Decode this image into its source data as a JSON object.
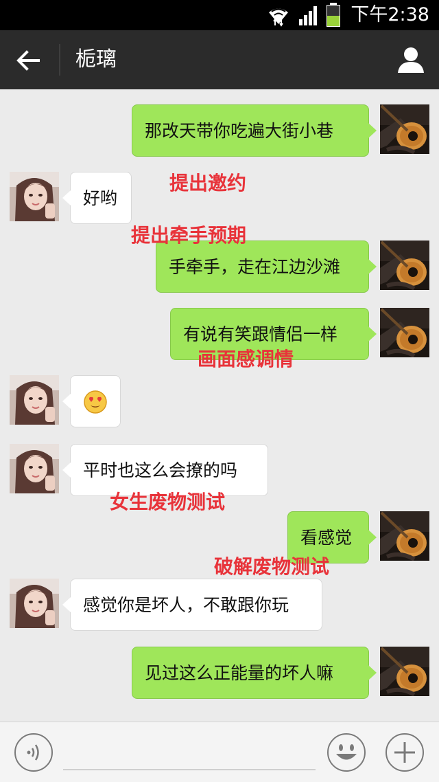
{
  "status_bar": {
    "time": "下午2:38"
  },
  "header": {
    "back_icon": "arrow-left-icon",
    "title": "栀璃",
    "profile_icon": "person-icon"
  },
  "messages": [
    {
      "side": "out",
      "text": "那改天带你吃遍大街小巷"
    },
    {
      "side": "in",
      "text": "好哟"
    },
    {
      "side": "out",
      "text": "手牵手，走在江边沙滩"
    },
    {
      "side": "out",
      "text": "有说有笑跟情侣一样"
    },
    {
      "side": "in",
      "text": "",
      "emoji": "heart-eyes-emoji"
    },
    {
      "side": "in",
      "text": "平时也这么会撩的吗"
    },
    {
      "side": "out",
      "text": "看感觉"
    },
    {
      "side": "in",
      "text": "感觉你是坏人，不敢跟你玩"
    },
    {
      "side": "out",
      "text": "见过这么正能量的坏人嘛"
    }
  ],
  "annotations": [
    "提出邀约",
    "提出牵手预期",
    "画面感调情",
    "女生废物测试",
    "破解废物测试"
  ],
  "input_bar": {
    "voice_icon": "voice-icon",
    "input_value": "",
    "emoji_icon": "smiley-icon",
    "more_icon": "plus-icon"
  },
  "colors": {
    "outgoing_bubble": "#9fe65a",
    "incoming_bubble": "#ffffff",
    "annotation": "#e8333a",
    "title_bar": "#2b2b2b"
  }
}
